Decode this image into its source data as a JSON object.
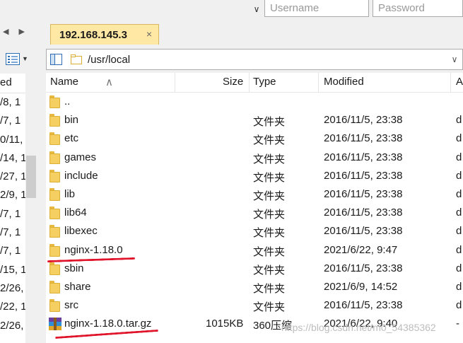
{
  "credentials": {
    "username_placeholder": "Username",
    "password_placeholder": "Password"
  },
  "left_pane": {
    "header": "ed",
    "rows": [
      "/8, 1",
      "/7, 1",
      "0/11,",
      "/14, 1",
      "/27, 1",
      "2/9, 1",
      "/7, 1",
      "/7, 1",
      "/7, 1",
      "/15, 1",
      "2/26,",
      "/22, 1",
      "2/26,"
    ]
  },
  "session_tab": {
    "label": "192.168.145.3",
    "close": "×"
  },
  "path": {
    "value": "/usr/local"
  },
  "columns": {
    "name": "Name",
    "size": "Size",
    "type": "Type",
    "modified": "Modified",
    "attrs": "A"
  },
  "files": [
    {
      "name": "..",
      "size": "",
      "type": "",
      "modified": "",
      "attr": "",
      "icon": "folder-icon"
    },
    {
      "name": "bin",
      "size": "",
      "type": "文件夹",
      "modified": "2016/11/5, 23:38",
      "attr": "d",
      "icon": "folder-icon"
    },
    {
      "name": "etc",
      "size": "",
      "type": "文件夹",
      "modified": "2016/11/5, 23:38",
      "attr": "d",
      "icon": "folder-icon"
    },
    {
      "name": "games",
      "size": "",
      "type": "文件夹",
      "modified": "2016/11/5, 23:38",
      "attr": "d",
      "icon": "folder-icon"
    },
    {
      "name": "include",
      "size": "",
      "type": "文件夹",
      "modified": "2016/11/5, 23:38",
      "attr": "d",
      "icon": "folder-icon"
    },
    {
      "name": "lib",
      "size": "",
      "type": "文件夹",
      "modified": "2016/11/5, 23:38",
      "attr": "d",
      "icon": "folder-icon"
    },
    {
      "name": "lib64",
      "size": "",
      "type": "文件夹",
      "modified": "2016/11/5, 23:38",
      "attr": "d",
      "icon": "folder-icon"
    },
    {
      "name": "libexec",
      "size": "",
      "type": "文件夹",
      "modified": "2016/11/5, 23:38",
      "attr": "d",
      "icon": "folder-icon"
    },
    {
      "name": "nginx-1.18.0",
      "size": "",
      "type": "文件夹",
      "modified": "2021/6/22, 9:47",
      "attr": "d",
      "icon": "folder-icon"
    },
    {
      "name": "sbin",
      "size": "",
      "type": "文件夹",
      "modified": "2016/11/5, 23:38",
      "attr": "d",
      "icon": "folder-icon"
    },
    {
      "name": "share",
      "size": "",
      "type": "文件夹",
      "modified": "2021/6/9, 14:52",
      "attr": "d",
      "icon": "folder-icon"
    },
    {
      "name": "src",
      "size": "",
      "type": "文件夹",
      "modified": "2016/11/5, 23:38",
      "attr": "d",
      "icon": "folder-icon"
    },
    {
      "name": "nginx-1.18.0.tar.gz",
      "size": "1015KB",
      "type": "360压缩",
      "modified": "2021/6/22, 9:40",
      "attr": "-",
      "icon": "archive-icon"
    }
  ],
  "watermark": "https://blog.csdn.net/m0_54385362",
  "colors": {
    "tab_bg": "#ffe8a3",
    "folder": "#f5cf61",
    "annotation_red": "#e0142a"
  }
}
